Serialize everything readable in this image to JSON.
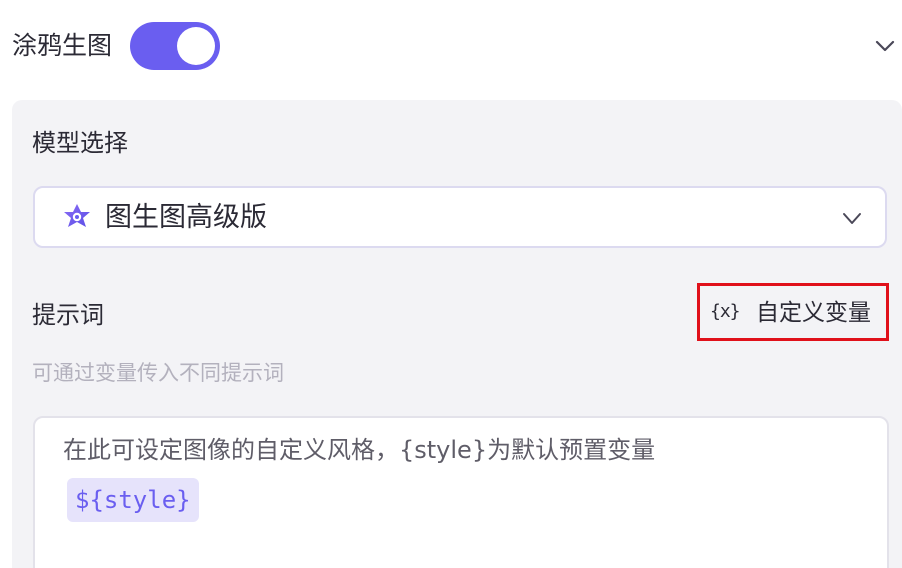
{
  "header": {
    "title": "涂鸦生图",
    "toggle_on": true
  },
  "model": {
    "label": "模型选择",
    "selected": "图生图高级版",
    "icon": "sparkle-logo-icon"
  },
  "prompt": {
    "label": "提示词",
    "custom_var_icon": "{x}",
    "custom_var_label": "自定义变量",
    "hint": "可通过变量传入不同提示词",
    "placeholder": "在此可设定图像的自定义风格，{style}为默认预置变量",
    "variable_chip": "${style}"
  },
  "colors": {
    "accent": "#6a5ef0",
    "highlight_border": "#e0101a",
    "panel_bg": "#f3f3f6"
  }
}
